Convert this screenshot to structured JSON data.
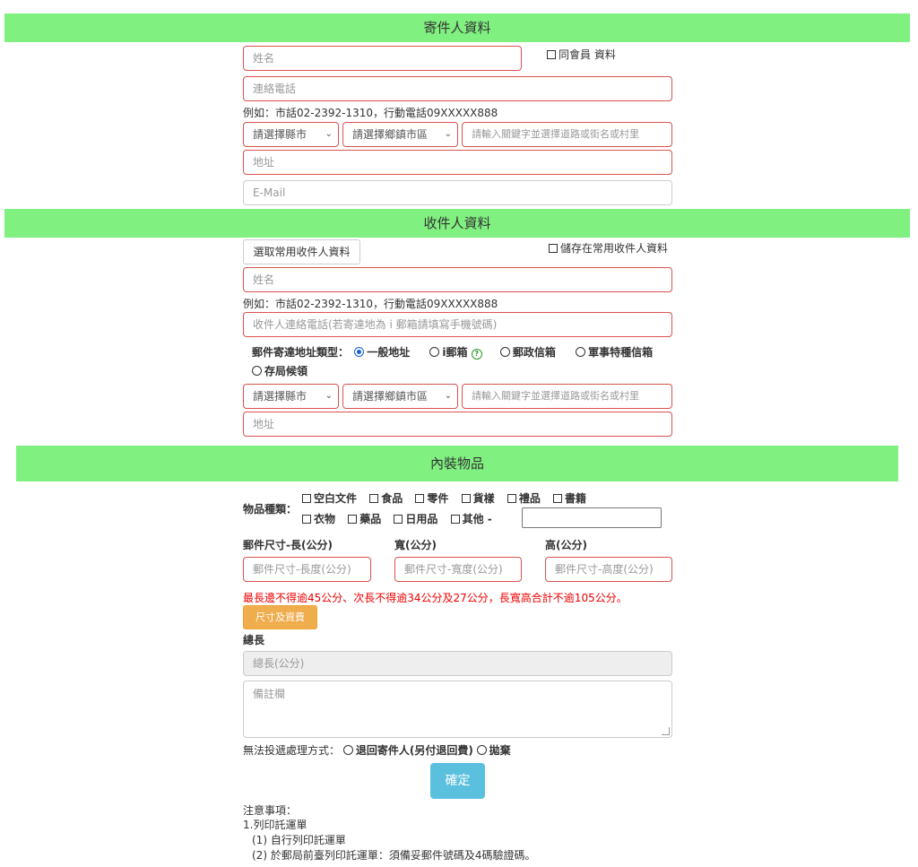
{
  "sender": {
    "title": "寄件人資料",
    "same_member_label": "同會員 資料",
    "name_placeholder": "姓名",
    "phone_placeholder": "連絡電話",
    "phone_example": "例如：市話02-2392-1310，行動電話09XXXXX888",
    "city_select": "請選擇縣市",
    "district_select": "請選擇鄉鎮市區",
    "road_placeholder": "請輸入關鍵字並選擇道路或街名或村里",
    "address_placeholder": "地址",
    "email_placeholder": "E-Mail"
  },
  "recipient": {
    "title": "收件人資料",
    "select_common_button": "選取常用收件人資料",
    "save_common_label": "儲存在常用收件人資料",
    "name_placeholder": "姓名",
    "phone_example": "例如：市話02-2392-1310，行動電話09XXXXX888",
    "phone_placeholder": "收件人連絡電話(若寄達地為 i 郵箱請填寫手機號碼)",
    "address_type_label": "郵件寄達地址類型：",
    "address_types": [
      "一般地址",
      "i郵箱",
      "郵政信箱",
      "軍事特種信箱",
      "存局候領"
    ],
    "address_type_selected": "一般地址",
    "city_select": "請選擇縣市",
    "district_select": "請選擇鄉鎮市區",
    "road_placeholder": "請輸入關鍵字並選擇道路或街名或村里",
    "address_placeholder": "地址"
  },
  "contents": {
    "title": "內裝物品",
    "item_type_label": "物品種類：",
    "item_types_row1": [
      "空白文件",
      "食品",
      "零件",
      "貨樣",
      "禮品",
      "書籍"
    ],
    "item_types_row2": [
      "衣物",
      "藥品",
      "日用品",
      "其他 -"
    ],
    "length_label": "郵件尺寸-長(公分)",
    "width_label": "寬(公分)",
    "height_label": "高(公分)",
    "length_placeholder": "郵件尺寸-長度(公分)",
    "width_placeholder": "郵件尺寸-寬度(公分)",
    "height_placeholder": "郵件尺寸-高度(公分)",
    "size_warning": "最長邊不得逾45公分、次長不得逾34公分及27公分，長寬高合計不逾105公分。",
    "size_fee_button": "尺寸及資費",
    "total_length_label": "總長",
    "total_length_placeholder": "總長(公分)",
    "remarks_placeholder": "備註欄",
    "undeliverable_label": "無法投遞處理方式：",
    "undeliverable_options": [
      "退回寄件人(另付退回費)",
      "拋棄"
    ],
    "confirm_button": "確定"
  },
  "notes": {
    "title": "注意事項：",
    "line1": "1.列印託運單",
    "line2": "(1) 自行列印託運單",
    "line3": "(2) 於郵局前臺列印託運單：須備妥郵件號碼及4碼驗證碼。"
  },
  "colors": {
    "banner": "#80f080",
    "error_border": "#d9534f",
    "orange_button": "#f0ad4e",
    "blue_button": "#5bc0de",
    "warning_text": "#ee0000"
  }
}
